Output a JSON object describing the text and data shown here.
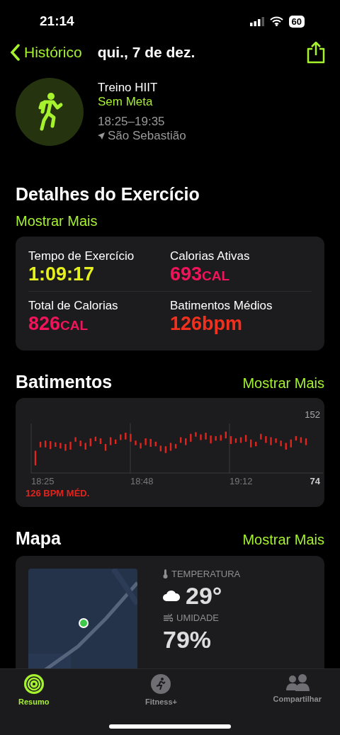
{
  "status_bar": {
    "time": "21:14",
    "battery": "60"
  },
  "nav": {
    "back": "Histórico",
    "title": "qui., 7 de dez."
  },
  "workout": {
    "name": "Treino HIIT",
    "goal": "Sem Meta",
    "time": "18:25–19:35",
    "location": "São Sebastião"
  },
  "details": {
    "title": "Detalhes do Exercício",
    "more": "Mostrar Mais",
    "metrics": [
      {
        "label": "Tempo de Exercício",
        "value": "1:09:17",
        "color": "#e6f01c"
      },
      {
        "label": "Calorias Ativas",
        "value": "693",
        "unit": "CAL",
        "color": "#f0145a"
      },
      {
        "label": "Total de Calorias",
        "value": "826",
        "unit": "CAL",
        "color": "#f0145a"
      },
      {
        "label": "Batimentos Médios",
        "value": "126bpm",
        "color": "#f2301e"
      }
    ]
  },
  "heart": {
    "title": "Batimentos",
    "more": "Mostrar Mais",
    "average": "126 BPM MÉD.",
    "max_label": "152",
    "min_label": "74",
    "time_labels": [
      "18:25",
      "18:48",
      "19:12"
    ]
  },
  "map": {
    "title": "Mapa",
    "more": "Mostrar Mais",
    "weather": [
      {
        "kind": "temperature",
        "label": "TEMPERATURA",
        "value": "29°"
      },
      {
        "kind": "humidity",
        "label": "UMIDADE",
        "value": "79%"
      }
    ]
  },
  "tabs": [
    {
      "kind": "summary",
      "label": "Resumo",
      "selected": true
    },
    {
      "kind": "fitness",
      "label": "Fitness+",
      "selected": false
    },
    {
      "kind": "sharing",
      "label": "Compartilhar",
      "selected": false
    }
  ]
}
